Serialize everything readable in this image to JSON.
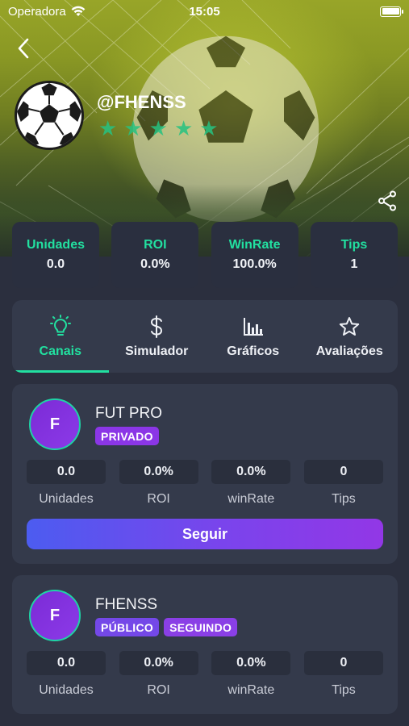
{
  "status_bar": {
    "carrier": "Operadora",
    "time": "15:05"
  },
  "profile": {
    "username": "@FHENSS",
    "rating": {
      "filled": 5,
      "max": 5
    }
  },
  "stats": [
    {
      "label": "Unidades",
      "value": "0.0"
    },
    {
      "label": "ROI",
      "value": "0.0%"
    },
    {
      "label": "WinRate",
      "value": "100.0%"
    },
    {
      "label": "Tips",
      "value": "1"
    }
  ],
  "tabs": [
    {
      "label": "Canais",
      "icon": "lightbulb-icon",
      "active": true
    },
    {
      "label": "Simulador",
      "icon": "dollar-icon",
      "active": false
    },
    {
      "label": "Gráficos",
      "icon": "bar-chart-icon",
      "active": false
    },
    {
      "label": "Avaliações",
      "icon": "star-icon",
      "active": false
    }
  ],
  "channels": [
    {
      "initial": "F",
      "name": "FUT PRO",
      "badges": [
        "PRIVADO"
      ],
      "stats": [
        {
          "value": "0.0",
          "caption": "Unidades"
        },
        {
          "value": "0.0%",
          "caption": "ROI"
        },
        {
          "value": "0.0%",
          "caption": "winRate"
        },
        {
          "value": "0",
          "caption": "Tips"
        }
      ],
      "action_label": "Seguir"
    },
    {
      "initial": "F",
      "name": "FHENSS",
      "badges": [
        "PÚBLICO",
        "SEGUINDO"
      ],
      "stats": [
        {
          "value": "0.0",
          "caption": "Unidades"
        },
        {
          "value": "0.0%",
          "caption": "ROI"
        },
        {
          "value": "0.0%",
          "caption": "winRate"
        },
        {
          "value": "0",
          "caption": "Tips"
        }
      ]
    }
  ],
  "colors": {
    "accent_green": "#22e0a0",
    "star_green": "#26c281",
    "card_bg": "#343a4b",
    "page_bg": "#2b2f3e",
    "purple": "#8b36e6",
    "gradient_start": "#4c5cf0",
    "gradient_end": "#9237e6"
  }
}
